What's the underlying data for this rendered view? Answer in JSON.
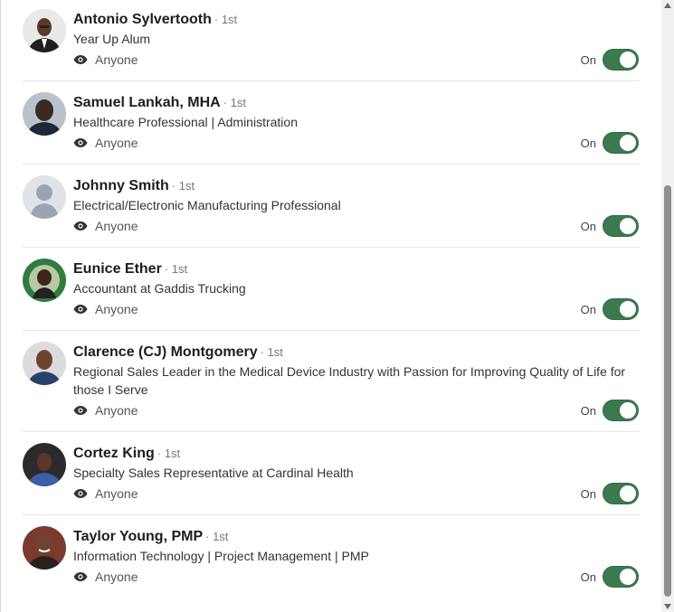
{
  "contacts": [
    {
      "name": "Antonio Sylvertooth",
      "degree": "· 1st",
      "headline": "Year Up Alum",
      "visibility": "Anyone",
      "toggle": "On",
      "avatar": "photo"
    },
    {
      "name": "Samuel Lankah, MHA",
      "degree": "· 1st",
      "headline": "Healthcare Professional | Administration",
      "visibility": "Anyone",
      "toggle": "On",
      "avatar": "photo"
    },
    {
      "name": "Johnny Smith",
      "degree": "· 1st",
      "headline": "Electrical/Electronic Manufacturing Professional",
      "visibility": "Anyone",
      "toggle": "On",
      "avatar": "placeholder"
    },
    {
      "name": "Eunice Ether",
      "degree": "· 1st",
      "headline": "Accountant at Gaddis Trucking",
      "visibility": "Anyone",
      "toggle": "On",
      "avatar": "photo"
    },
    {
      "name": "Clarence (CJ) Montgomery",
      "degree": "· 1st",
      "headline": "Regional Sales Leader in the Medical Device Industry with Passion for Improving Quality of Life for those I Serve",
      "visibility": "Anyone",
      "toggle": "On",
      "avatar": "photo"
    },
    {
      "name": "Cortez King",
      "degree": "· 1st",
      "headline": "Specialty Sales Representative at Cardinal Health",
      "visibility": "Anyone",
      "toggle": "On",
      "avatar": "photo"
    },
    {
      "name": "Taylor Young, PMP",
      "degree": "· 1st",
      "headline": "Information Technology | Project Management | PMP",
      "visibility": "Anyone",
      "toggle": "On",
      "avatar": "photo"
    }
  ],
  "icons": {
    "visibility": "eye-icon"
  },
  "colors": {
    "toggle_on": "#3b7a4e"
  }
}
